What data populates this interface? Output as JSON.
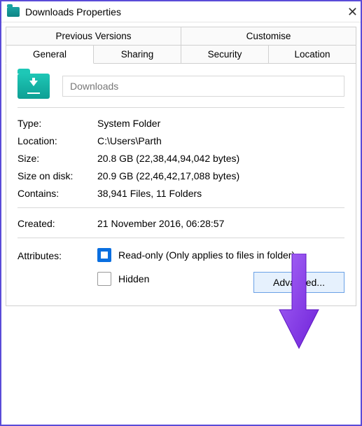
{
  "window": {
    "title": "Downloads Properties"
  },
  "tabs": {
    "row1": [
      "Previous Versions",
      "Customise"
    ],
    "row2": [
      "General",
      "Sharing",
      "Security",
      "Location"
    ],
    "active": "General"
  },
  "folder": {
    "name": "Downloads"
  },
  "props": {
    "type_label": "Type:",
    "type_value": "System Folder",
    "location_label": "Location:",
    "location_value": "C:\\Users\\Parth",
    "size_label": "Size:",
    "size_value": "20.8 GB (22,38,44,94,042 bytes)",
    "sizeondisk_label": "Size on disk:",
    "sizeondisk_value": "20.9 GB (22,46,42,17,088 bytes)",
    "contains_label": "Contains:",
    "contains_value": "38,941 Files, 11 Folders",
    "created_label": "Created:",
    "created_value": "21 November 2016, 06:28:57"
  },
  "attributes": {
    "label": "Attributes:",
    "readonly_label": "Read-only (Only applies to files in folder)",
    "readonly_checked": true,
    "hidden_label": "Hidden",
    "hidden_checked": false,
    "advanced_label": "Advanced..."
  },
  "annotation": {
    "color": "#8a3cf0"
  }
}
